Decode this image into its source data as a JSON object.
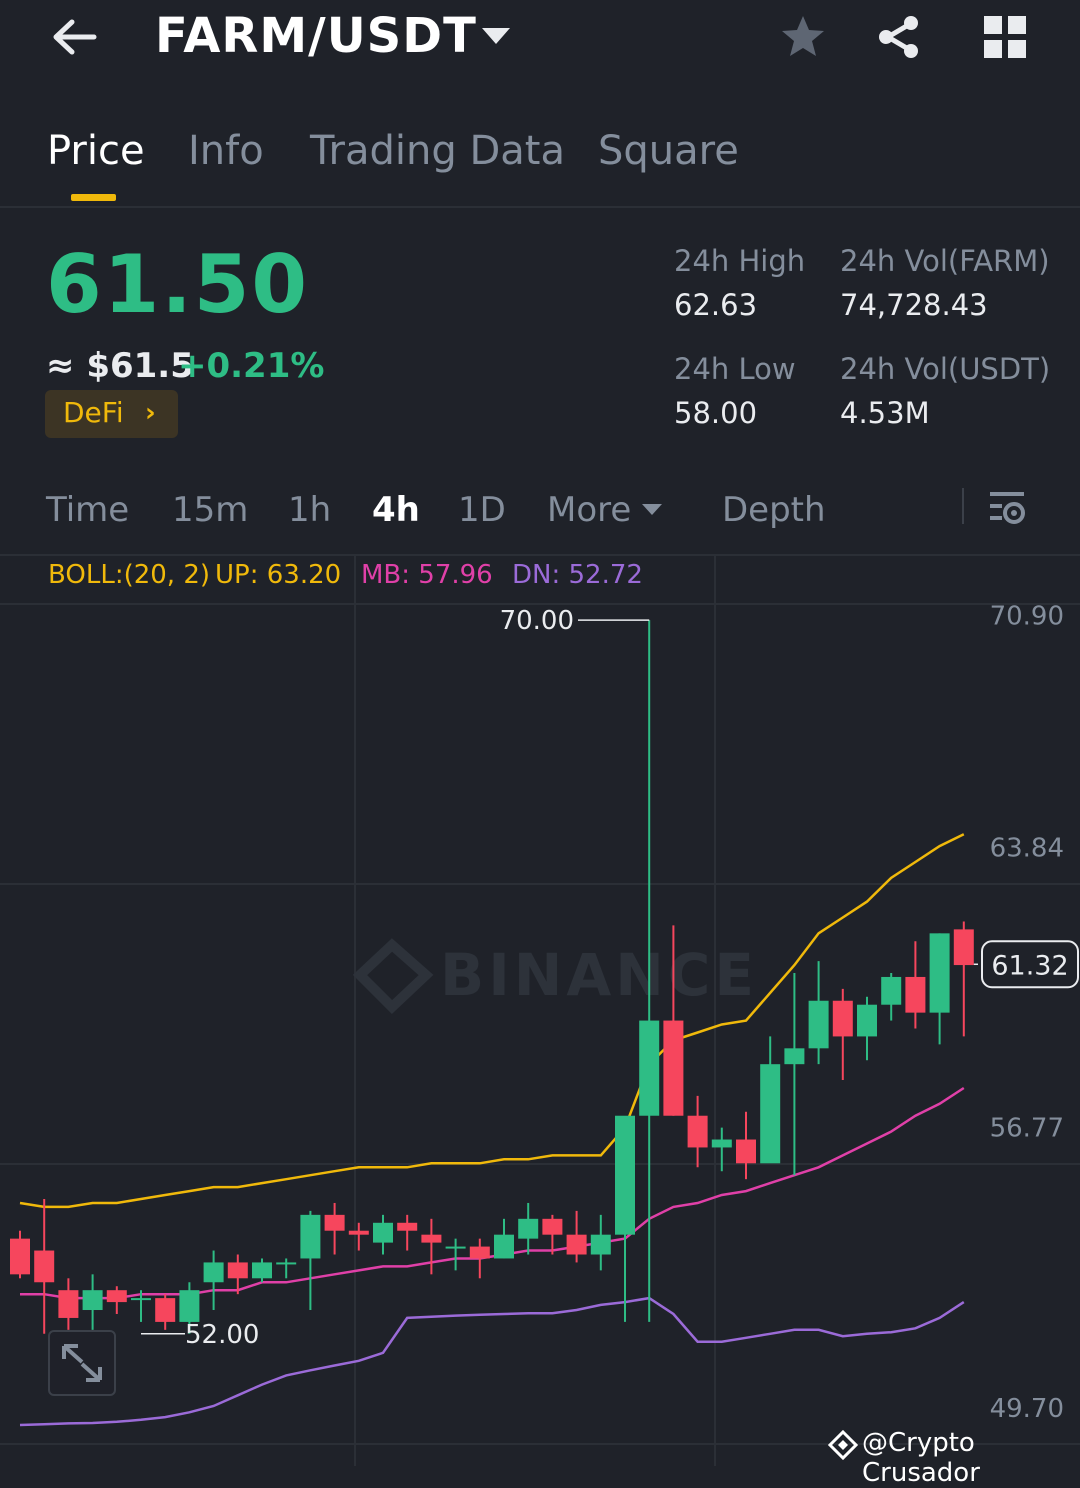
{
  "header": {
    "pair": "FARM/USDT"
  },
  "tabs": [
    {
      "label": "Price",
      "active": true
    },
    {
      "label": "Info",
      "active": false
    },
    {
      "label": "Trading Data",
      "active": false
    },
    {
      "label": "Square",
      "active": false
    }
  ],
  "ticker": {
    "last_price": "61.50",
    "usd_price": "≈ $61.5",
    "change": "+0.21%",
    "tag": "DeFi",
    "high_label": "24h High",
    "high_value": "62.63",
    "low_label": "24h Low",
    "low_value": "58.00",
    "vol_base_label": "24h Vol(FARM)",
    "vol_base_value": "74,728.43",
    "vol_quote_label": "24h Vol(USDT)",
    "vol_quote_value": "4.53M"
  },
  "intervals": [
    {
      "label": "Time",
      "active": false
    },
    {
      "label": "15m",
      "active": false
    },
    {
      "label": "1h",
      "active": false
    },
    {
      "label": "4h",
      "active": true
    },
    {
      "label": "1D",
      "active": false
    },
    {
      "label": "More",
      "active": false
    },
    {
      "label": "Depth",
      "active": false
    }
  ],
  "indicator": {
    "boll": "BOLL:(20, 2)",
    "up": "UP: 63.20",
    "mb": "MB: 57.96",
    "dn": "DN: 52.72"
  },
  "chart_data": {
    "type": "candlestick",
    "y_ticks": [
      70.9,
      63.84,
      56.77,
      49.7
    ],
    "ylim": [
      49.7,
      70.9
    ],
    "y_tick_labels": [
      "70.90",
      "63.84",
      "56.77",
      "49.70"
    ],
    "high_marker": {
      "label": "70.00",
      "value": 70.0
    },
    "low_marker": {
      "label": "52.00",
      "value": 52.0
    },
    "current_price": {
      "label": "61.32",
      "value": 61.32
    },
    "watermark": "BINANCE",
    "candles": [
      {
        "o": 54.4,
        "h": 54.6,
        "l": 53.4,
        "c": 53.5
      },
      {
        "o": 54.1,
        "h": 55.4,
        "l": 52.0,
        "c": 53.3
      },
      {
        "o": 53.1,
        "h": 53.4,
        "l": 52.1,
        "c": 52.4
      },
      {
        "o": 52.6,
        "h": 53.5,
        "l": 52.1,
        "c": 53.1
      },
      {
        "o": 53.1,
        "h": 53.2,
        "l": 52.5,
        "c": 52.8
      },
      {
        "o": 52.9,
        "h": 53.1,
        "l": 52.3,
        "c": 52.9
      },
      {
        "o": 52.9,
        "h": 53.0,
        "l": 52.1,
        "c": 52.3
      },
      {
        "o": 52.3,
        "h": 53.3,
        "l": 52.0,
        "c": 53.1
      },
      {
        "o": 53.3,
        "h": 54.1,
        "l": 52.6,
        "c": 53.8
      },
      {
        "o": 53.8,
        "h": 54.0,
        "l": 53.0,
        "c": 53.4
      },
      {
        "o": 53.4,
        "h": 53.9,
        "l": 53.3,
        "c": 53.8
      },
      {
        "o": 53.8,
        "h": 53.9,
        "l": 53.4,
        "c": 53.8
      },
      {
        "o": 53.9,
        "h": 55.1,
        "l": 52.6,
        "c": 55.0
      },
      {
        "o": 55.0,
        "h": 55.3,
        "l": 54.0,
        "c": 54.6
      },
      {
        "o": 54.6,
        "h": 54.8,
        "l": 54.1,
        "c": 54.5
      },
      {
        "o": 54.3,
        "h": 55.0,
        "l": 54.0,
        "c": 54.8
      },
      {
        "o": 54.8,
        "h": 55.0,
        "l": 54.1,
        "c": 54.6
      },
      {
        "o": 54.5,
        "h": 54.9,
        "l": 53.5,
        "c": 54.3
      },
      {
        "o": 54.2,
        "h": 54.4,
        "l": 53.6,
        "c": 54.2
      },
      {
        "o": 54.2,
        "h": 54.4,
        "l": 53.4,
        "c": 53.9
      },
      {
        "o": 53.9,
        "h": 54.9,
        "l": 53.9,
        "c": 54.5
      },
      {
        "o": 54.4,
        "h": 55.3,
        "l": 54.0,
        "c": 54.9
      },
      {
        "o": 54.9,
        "h": 55.0,
        "l": 54.0,
        "c": 54.5
      },
      {
        "o": 54.5,
        "h": 55.1,
        "l": 53.8,
        "c": 54.0
      },
      {
        "o": 54.0,
        "h": 55.0,
        "l": 53.6,
        "c": 54.5
      },
      {
        "o": 54.5,
        "h": 57.3,
        "l": 52.3,
        "c": 57.5
      },
      {
        "o": 57.5,
        "h": 70.0,
        "l": 52.3,
        "c": 59.9
      },
      {
        "o": 59.9,
        "h": 62.3,
        "l": 57.5,
        "c": 57.5
      },
      {
        "o": 57.5,
        "h": 58.0,
        "l": 56.2,
        "c": 56.7
      },
      {
        "o": 56.7,
        "h": 57.2,
        "l": 56.1,
        "c": 56.9
      },
      {
        "o": 56.9,
        "h": 57.6,
        "l": 55.9,
        "c": 56.3
      },
      {
        "o": 56.3,
        "h": 59.5,
        "l": 56.4,
        "c": 58.8
      },
      {
        "o": 58.8,
        "h": 61.1,
        "l": 56.0,
        "c": 59.2
      },
      {
        "o": 59.2,
        "h": 61.4,
        "l": 58.8,
        "c": 60.4
      },
      {
        "o": 60.4,
        "h": 60.7,
        "l": 58.4,
        "c": 59.5
      },
      {
        "o": 59.5,
        "h": 60.5,
        "l": 58.9,
        "c": 60.3
      },
      {
        "o": 60.3,
        "h": 61.1,
        "l": 59.9,
        "c": 61.0
      },
      {
        "o": 61.0,
        "h": 61.9,
        "l": 59.7,
        "c": 60.1
      },
      {
        "o": 60.1,
        "h": 62.1,
        "l": 59.3,
        "c": 62.1
      },
      {
        "o": 62.2,
        "h": 62.4,
        "l": 59.5,
        "c": 61.3
      }
    ],
    "boll_up": [
      55.3,
      55.2,
      55.2,
      55.3,
      55.3,
      55.4,
      55.5,
      55.6,
      55.7,
      55.7,
      55.8,
      55.9,
      56.0,
      56.1,
      56.2,
      56.2,
      56.2,
      56.3,
      56.3,
      56.3,
      56.4,
      56.4,
      56.5,
      56.5,
      56.5,
      57.2,
      58.8,
      59.4,
      59.6,
      59.8,
      59.9,
      60.6,
      61.3,
      62.1,
      62.5,
      62.9,
      63.5,
      63.9,
      64.3,
      64.6
    ],
    "boll_mb": [
      53.0,
      53.0,
      52.9,
      52.9,
      52.9,
      53.0,
      53.0,
      53.0,
      53.1,
      53.1,
      53.3,
      53.3,
      53.4,
      53.5,
      53.6,
      53.7,
      53.7,
      53.8,
      53.9,
      53.9,
      54.0,
      54.1,
      54.1,
      54.2,
      54.3,
      54.4,
      54.9,
      55.2,
      55.3,
      55.5,
      55.6,
      55.8,
      56.0,
      56.2,
      56.5,
      56.8,
      57.1,
      57.5,
      57.8,
      58.2
    ],
    "boll_dn": [
      49.7,
      49.72,
      49.74,
      49.75,
      49.78,
      49.83,
      49.9,
      50.02,
      50.18,
      50.45,
      50.72,
      50.95,
      51.08,
      51.2,
      51.32,
      51.52,
      52.4,
      52.43,
      52.46,
      52.48,
      52.5,
      52.52,
      52.52,
      52.6,
      52.73,
      52.8,
      52.9,
      52.5,
      51.8,
      51.8,
      51.9,
      52.0,
      52.1,
      52.1,
      51.94,
      52.0,
      52.04,
      52.14,
      52.4,
      52.8
    ]
  },
  "footer": {
    "credit": "@Crypto Crusador"
  }
}
